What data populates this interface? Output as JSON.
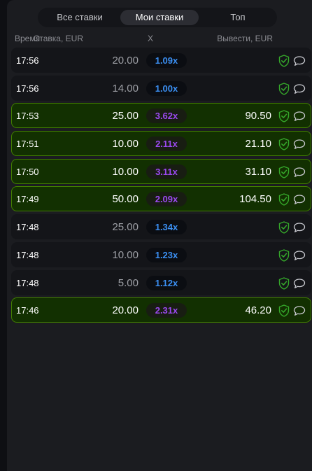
{
  "tabs": [
    {
      "label": "Все ставки"
    },
    {
      "label": "Мои ставки"
    },
    {
      "label": "Топ"
    }
  ],
  "headers": {
    "time": "Время",
    "bet": "Ставка, EUR",
    "mult": "X",
    "cashout": "Вывести, EUR"
  },
  "colors": {
    "win_bg": "#123001",
    "win_border": "#427f00",
    "mult_low": "#3b8ff2",
    "mult_high": "#9b49ef",
    "shield": "#35a72a"
  },
  "icons": {
    "verify": "shield-check-icon",
    "chat": "chat-bubble-icon"
  },
  "rows": [
    {
      "time": "17:56",
      "bet": "20.00",
      "mult": "1.09x",
      "cashout": "",
      "win": false
    },
    {
      "time": "17:56",
      "bet": "14.00",
      "mult": "1.00x",
      "cashout": "",
      "win": false
    },
    {
      "time": "17:53",
      "bet": "25.00",
      "mult": "3.62x",
      "cashout": "90.50",
      "win": true
    },
    {
      "time": "17:51",
      "bet": "10.00",
      "mult": "2.11x",
      "cashout": "21.10",
      "win": true
    },
    {
      "time": "17:50",
      "bet": "10.00",
      "mult": "3.11x",
      "cashout": "31.10",
      "win": true
    },
    {
      "time": "17:49",
      "bet": "50.00",
      "mult": "2.09x",
      "cashout": "104.50",
      "win": true
    },
    {
      "time": "17:48",
      "bet": "25.00",
      "mult": "1.34x",
      "cashout": "",
      "win": false
    },
    {
      "time": "17:48",
      "bet": "10.00",
      "mult": "1.23x",
      "cashout": "",
      "win": false
    },
    {
      "time": "17:48",
      "bet": "5.00",
      "mult": "1.12x",
      "cashout": "",
      "win": false
    },
    {
      "time": "17:46",
      "bet": "20.00",
      "mult": "2.31x",
      "cashout": "46.20",
      "win": true
    }
  ]
}
